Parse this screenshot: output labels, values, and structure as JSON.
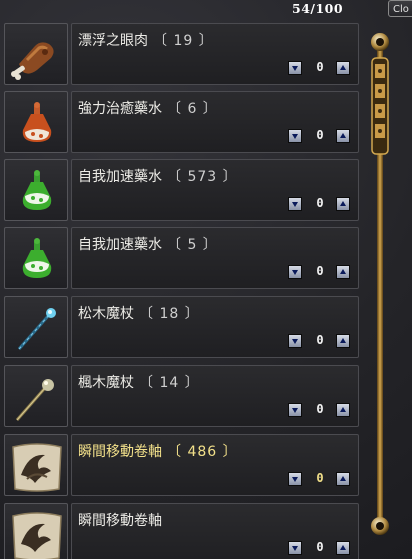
{
  "inventory": {
    "counter": "54/100",
    "close_label": "Clo",
    "items": [
      {
        "name": "漂浮之眼肉",
        "count": "〔 19 〕",
        "icon": "eye-meat-icon",
        "qty": "0",
        "highlight": false
      },
      {
        "name": "強力治癒藥水",
        "count": "〔 6 〕",
        "icon": "orange-potion-icon",
        "qty": "0",
        "highlight": false
      },
      {
        "name": "自我加速藥水",
        "count": "〔 573 〕",
        "icon": "green-potion-icon",
        "qty": "0",
        "highlight": false
      },
      {
        "name": "自我加速藥水",
        "count": "〔 5 〕",
        "icon": "green-potion-icon",
        "qty": "0",
        "highlight": false
      },
      {
        "name": "松木魔杖",
        "count": "〔 18 〕",
        "icon": "pine-wand-icon",
        "qty": "0",
        "highlight": false
      },
      {
        "name": "楓木魔杖",
        "count": "〔 14 〕",
        "icon": "maple-wand-icon",
        "qty": "0",
        "highlight": false
      },
      {
        "name": "瞬間移動卷軸",
        "count": "〔 486 〕",
        "icon": "teleport-scroll-icon",
        "qty": "0",
        "highlight": true
      },
      {
        "name": "瞬間移動卷軸",
        "count": "",
        "icon": "teleport-scroll-icon",
        "qty": "0",
        "highlight": false
      }
    ],
    "colors": {
      "highlight_text": "#f2e08a",
      "normal_text": "#ecebe6",
      "arrow_button": "#b8bfce"
    }
  }
}
